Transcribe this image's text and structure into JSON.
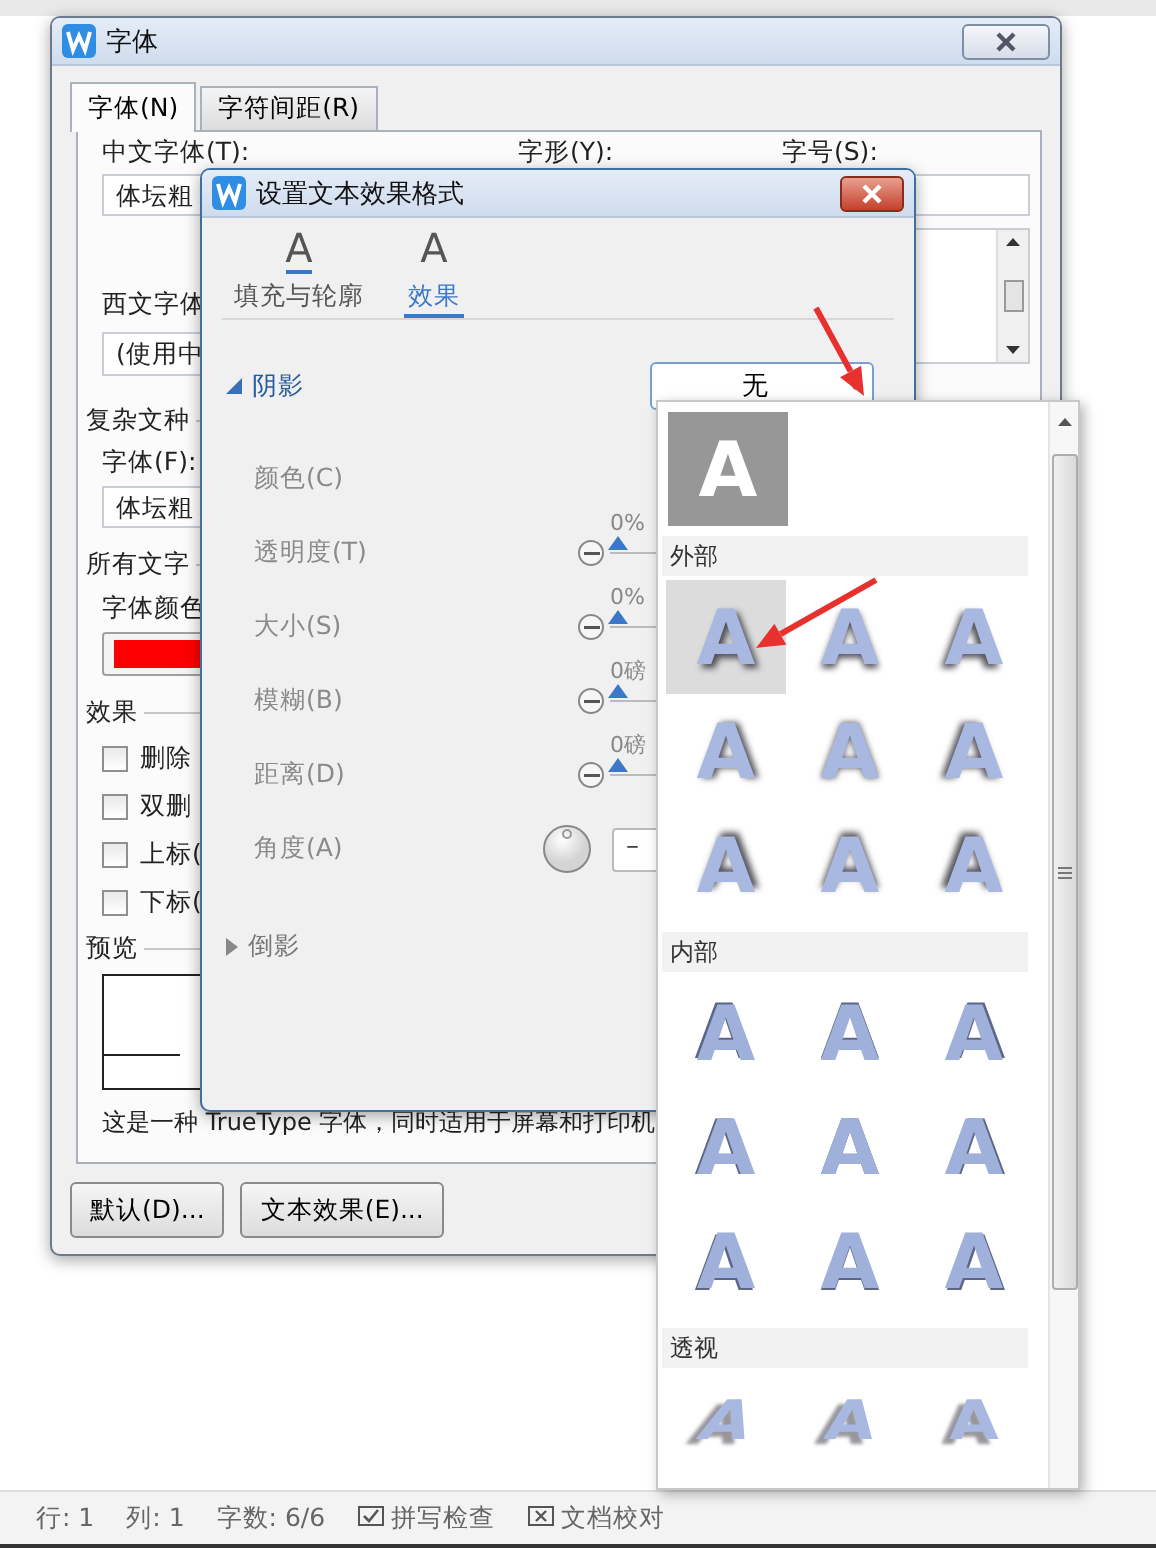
{
  "font_dialog": {
    "title": "字体",
    "tabs": [
      {
        "label": "字体(N)",
        "selected": true
      },
      {
        "label": "字符间距(R)",
        "selected": false
      }
    ],
    "chinese_font": {
      "label": "中文字体(T):",
      "value": "体坛粗"
    },
    "style": {
      "label": "字形(Y):"
    },
    "size": {
      "label": "字号(S):"
    },
    "western_font": {
      "label": "西文字体",
      "value": "(使用中"
    },
    "complex_section": "复杂文种",
    "complex_font": {
      "label": "字体(F):",
      "value": "体坛粗"
    },
    "all_text_section": "所有文字",
    "font_color": {
      "label": "字体颜色",
      "color": "#ff0000"
    },
    "effects_section": "效果",
    "effects": [
      {
        "label": "删除",
        "checked": false
      },
      {
        "label": "双删",
        "checked": false
      },
      {
        "label": "上标(",
        "checked": false
      },
      {
        "label": "下标(",
        "checked": false
      }
    ],
    "preview_section": "预览",
    "description": "这是一种 TrueType 字体，同时适用于屏幕和打印机",
    "buttons": [
      "默认(D)...",
      "文本效果(E)..."
    ]
  },
  "effect_dialog": {
    "title": "设置文本效果格式",
    "tabs": [
      {
        "icon_text": "A",
        "label": "填充与轮廓",
        "selected": false
      },
      {
        "icon_text": "A",
        "label": "效果",
        "selected": true
      }
    ],
    "sections": [
      {
        "title": "阴影",
        "expanded": true,
        "preset": "无",
        "rows": [
          {
            "label": "颜色(C)",
            "disabled": true
          },
          {
            "kind": "slider",
            "label": "透明度(T)",
            "reading": "0%",
            "level": 0,
            "disabled": true
          },
          {
            "kind": "slider",
            "label": "大小(S)",
            "reading": "0%",
            "level": 0,
            "disabled": true
          },
          {
            "kind": "slider",
            "label": "模糊(B)",
            "reading": "0磅",
            "level": 0,
            "disabled": true
          },
          {
            "kind": "slider",
            "label": "距离(D)",
            "reading": "0磅",
            "level": 0,
            "disabled": true
          },
          {
            "kind": "angle",
            "label": "角度(A)",
            "value": "–",
            "disabled": true
          }
        ]
      },
      {
        "title": "倒影",
        "expanded": false
      }
    ]
  },
  "shadow_popup": {
    "none_tile": {
      "label": "A",
      "selected": true
    },
    "groups": [
      {
        "kind": "outer",
        "title": "外部",
        "tiles": [
          {
            "label": "A",
            "hovered": true
          },
          {
            "label": "A",
            "hovered": false
          },
          {
            "label": "A",
            "hovered": false
          },
          {
            "label": "A",
            "hovered": false
          },
          {
            "label": "A",
            "hovered": false
          },
          {
            "label": "A",
            "hovered": false
          },
          {
            "label": "A",
            "hovered": false
          },
          {
            "label": "A",
            "hovered": false
          },
          {
            "label": "A",
            "hovered": false
          }
        ]
      },
      {
        "kind": "inner",
        "title": "内部",
        "tiles": [
          {
            "label": "A",
            "hovered": false
          },
          {
            "label": "A",
            "hovered": false
          },
          {
            "label": "A",
            "hovered": false
          },
          {
            "label": "A",
            "hovered": false
          },
          {
            "label": "A",
            "hovered": false
          },
          {
            "label": "A",
            "hovered": false
          },
          {
            "label": "A",
            "hovered": false
          },
          {
            "label": "A",
            "hovered": false
          },
          {
            "label": "A",
            "hovered": false
          }
        ]
      },
      {
        "kind": "perspective",
        "title": "透视",
        "tiles": [
          {
            "label": "A",
            "hovered": false
          },
          {
            "label": "A",
            "hovered": false
          },
          {
            "label": "A",
            "hovered": false
          }
        ]
      }
    ]
  },
  "status_bar": [
    {
      "kind": "text",
      "text": "行: 1"
    },
    {
      "kind": "text",
      "text": "列: 1"
    },
    {
      "kind": "text",
      "text": "字数: 6/6"
    },
    {
      "kind": "check",
      "text": "拼写检查"
    },
    {
      "kind": "cross",
      "text": "文档校对"
    }
  ]
}
